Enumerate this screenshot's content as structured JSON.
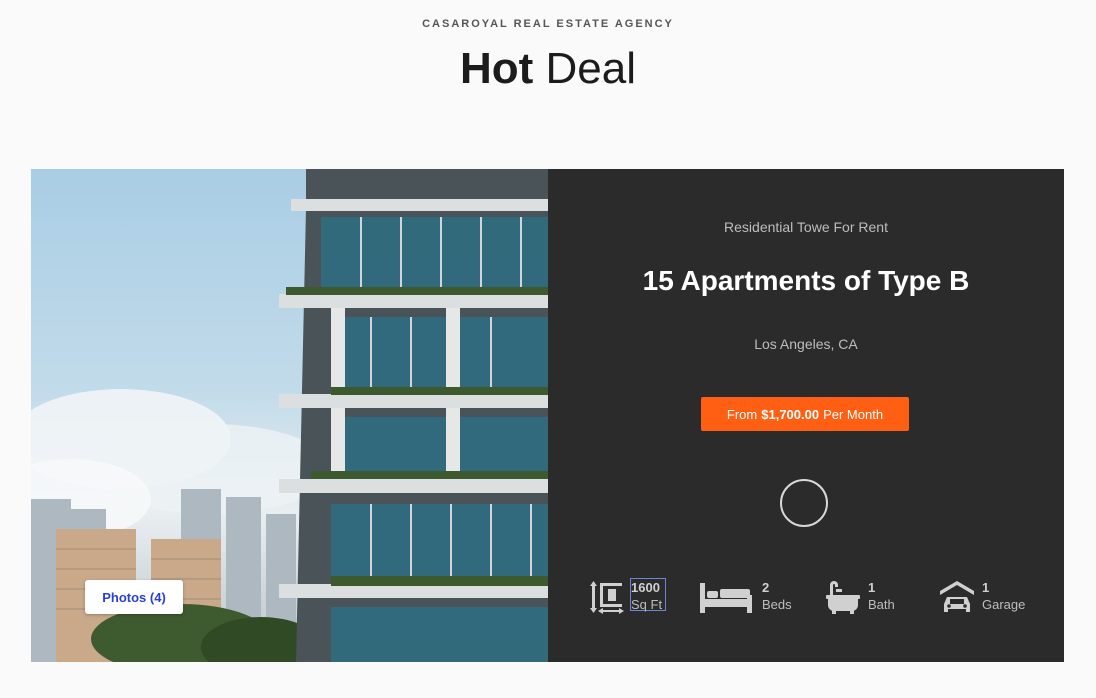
{
  "header": {
    "eyebrow": "CASAROYAL REAL ESTATE AGENCY",
    "title_bold": "Hot",
    "title_light": "Deal"
  },
  "listing": {
    "photos_label": "Photos (4)",
    "category": "Residential Towe For Rent",
    "title": "15 Apartments of Type B",
    "location": "Los Angeles, CA",
    "price": {
      "prefix": "From",
      "amount": "$1,700.00",
      "suffix": "Per Month"
    },
    "features": [
      {
        "icon": "area-icon",
        "value": "1600",
        "label": "Sq Ft"
      },
      {
        "icon": "bed-icon",
        "value": "2",
        "label": "Beds"
      },
      {
        "icon": "bathtub-icon",
        "value": "1",
        "label": "Bath"
      },
      {
        "icon": "garage-icon",
        "value": "1",
        "label": "Garage"
      }
    ]
  },
  "colors": {
    "accent": "#ff5f13",
    "panel": "#2b2b2b",
    "link": "#2a3fd6"
  }
}
